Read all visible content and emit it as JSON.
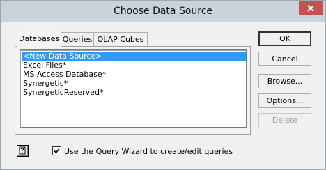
{
  "window": {
    "title": "Choose Data Source"
  },
  "tabs": [
    {
      "label": "Databases",
      "active": true
    },
    {
      "label": "Queries",
      "active": false
    },
    {
      "label": "OLAP Cubes",
      "active": false
    }
  ],
  "list": {
    "items": [
      {
        "label": "<New Data Source>",
        "selected": true
      },
      {
        "label": "Excel Files*",
        "selected": false
      },
      {
        "label": "MS Access Database*",
        "selected": false
      },
      {
        "label": "Synergetic*",
        "selected": false
      },
      {
        "label": "SynergeticReserved*",
        "selected": false
      }
    ]
  },
  "buttons": {
    "ok": "OK",
    "cancel": "Cancel",
    "browse": "Browse...",
    "options": "Options...",
    "delete": "Delete"
  },
  "footer": {
    "help_icon": "help-question-icon",
    "wizard_checkbox_label": "Use the Query Wizard to create/edit queries",
    "wizard_checked": true
  },
  "colors": {
    "selection": "#3399ff",
    "close_button": "#c75050",
    "titlebar": "#c9d3dc"
  }
}
